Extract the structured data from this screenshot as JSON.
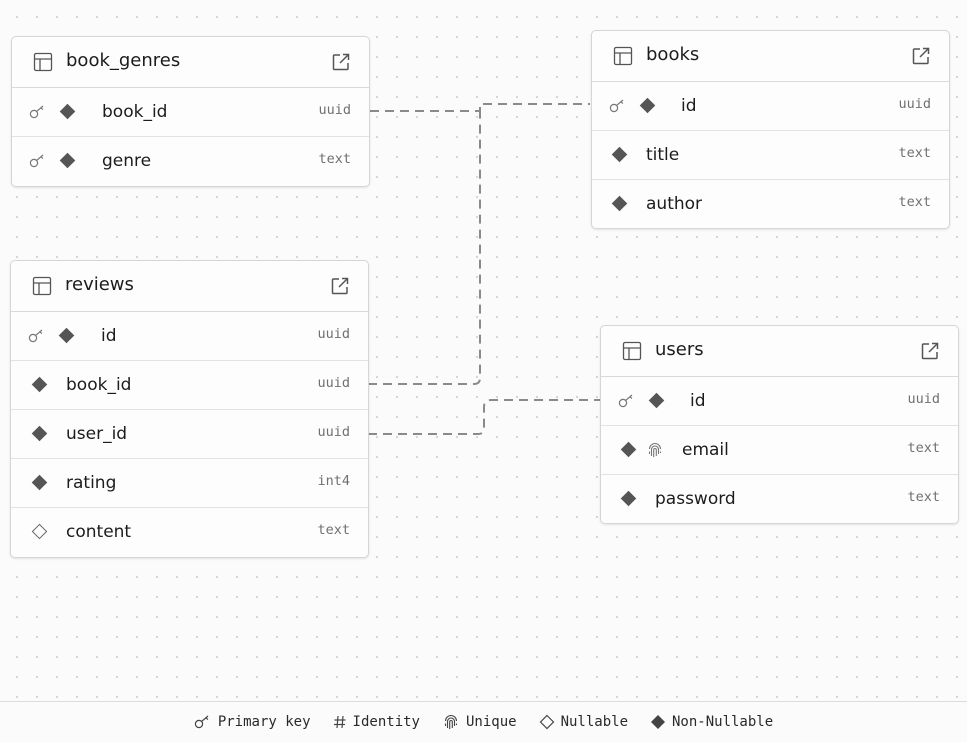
{
  "tables": {
    "book_genres": {
      "name": "book_genres",
      "columns": [
        {
          "name": "book_id",
          "type": "uuid",
          "primary_key": true,
          "nullable": false
        },
        {
          "name": "genre",
          "type": "text",
          "primary_key": true,
          "nullable": false
        }
      ]
    },
    "books": {
      "name": "books",
      "columns": [
        {
          "name": "id",
          "type": "uuid",
          "primary_key": true,
          "nullable": false
        },
        {
          "name": "title",
          "type": "text",
          "primary_key": false,
          "nullable": false
        },
        {
          "name": "author",
          "type": "text",
          "primary_key": false,
          "nullable": false
        }
      ]
    },
    "reviews": {
      "name": "reviews",
      "columns": [
        {
          "name": "id",
          "type": "uuid",
          "primary_key": true,
          "nullable": false
        },
        {
          "name": "book_id",
          "type": "uuid",
          "primary_key": false,
          "nullable": false
        },
        {
          "name": "user_id",
          "type": "uuid",
          "primary_key": false,
          "nullable": false
        },
        {
          "name": "rating",
          "type": "int4",
          "primary_key": false,
          "nullable": false
        },
        {
          "name": "content",
          "type": "text",
          "primary_key": false,
          "nullable": true
        }
      ]
    },
    "users": {
      "name": "users",
      "columns": [
        {
          "name": "id",
          "type": "uuid",
          "primary_key": true,
          "nullable": false
        },
        {
          "name": "email",
          "type": "text",
          "primary_key": false,
          "nullable": false,
          "unique": true
        },
        {
          "name": "password",
          "type": "text",
          "primary_key": false,
          "nullable": false
        }
      ]
    }
  },
  "relationships": [
    {
      "from": "book_genres.book_id",
      "to": "books.id"
    },
    {
      "from": "reviews.book_id",
      "to": "books.id"
    },
    {
      "from": "reviews.user_id",
      "to": "users.id"
    }
  ],
  "legend": {
    "primary_key": "Primary key",
    "identity": "Identity",
    "unique": "Unique",
    "nullable": "Nullable",
    "non_nullable": "Non-Nullable"
  },
  "colors": {
    "background": "#fbfbfb",
    "grid_dot": "#d4d4d4",
    "card_border": "#d6d6d6",
    "edge": "#8a8a8a",
    "diamond": "#555555",
    "type_text": "#707070"
  }
}
